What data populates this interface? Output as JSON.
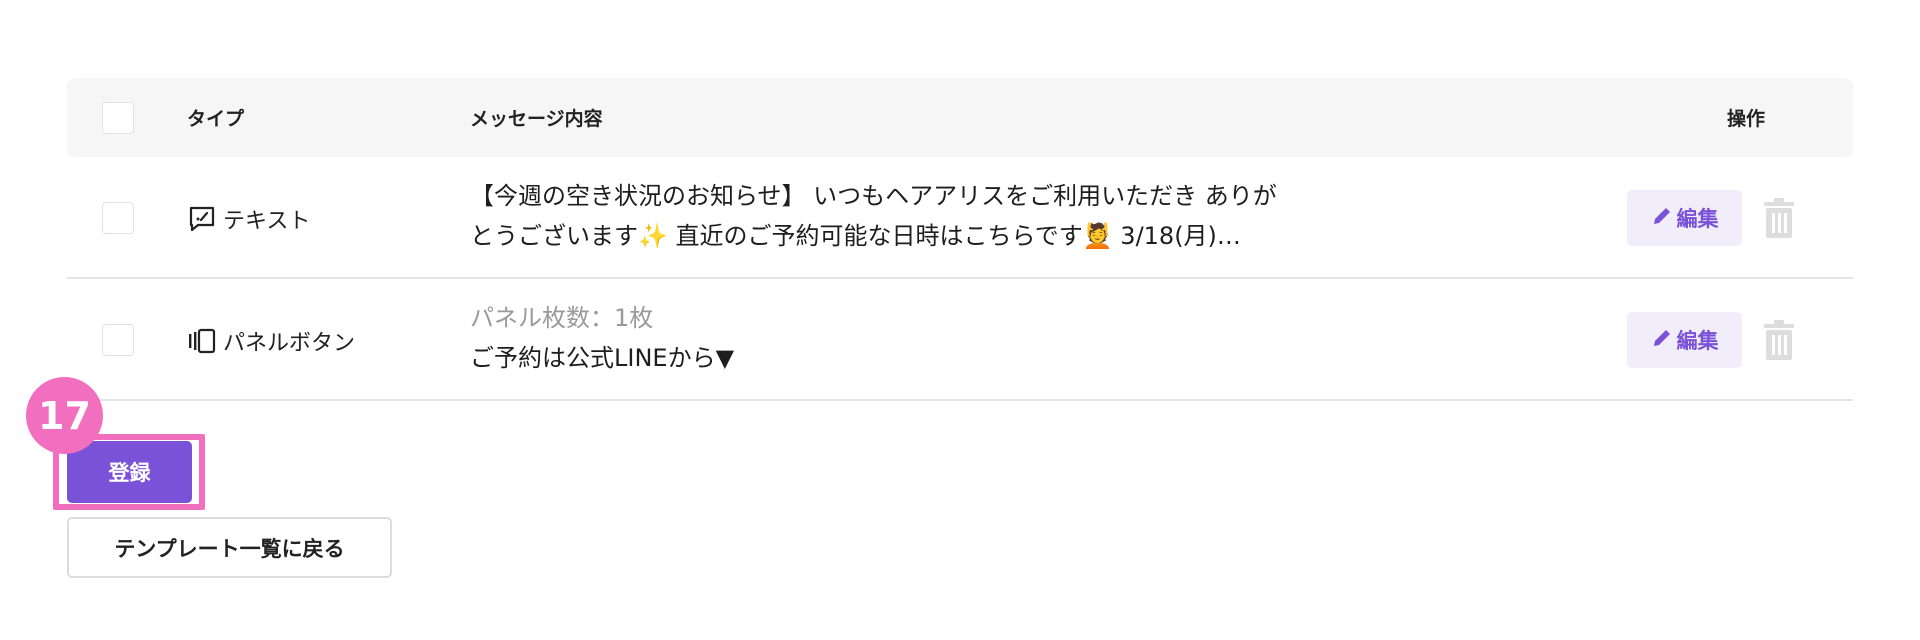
{
  "table": {
    "headers": {
      "type": "タイプ",
      "message": "メッセージ内容",
      "actions": "操作"
    },
    "rows": [
      {
        "type_icon": "speech-bubble-icon",
        "type_label": "テキスト",
        "message_line1": "【今週の空き状況のお知らせ】 いつもヘアアリスをご利用いただき ありが",
        "message_line2": "とうございます✨ 直近のご予約可能な日時はこちらです💆 3/18(月)…",
        "edit_label": "編集"
      },
      {
        "type_icon": "panel-icon",
        "type_label": "パネルボタン",
        "message_sub": "パネル枚数：1枚",
        "message_line1": "ご予約は公式LINEから▼",
        "edit_label": "編集"
      }
    ]
  },
  "step_badge": "17",
  "register_label": "登録",
  "back_label": "テンプレート一覧に戻る",
  "colors": {
    "accent": "#7a52d8",
    "accent_light": "#f1edfb",
    "highlight": "#f26ebf",
    "header_bg": "#f6f6f6"
  }
}
